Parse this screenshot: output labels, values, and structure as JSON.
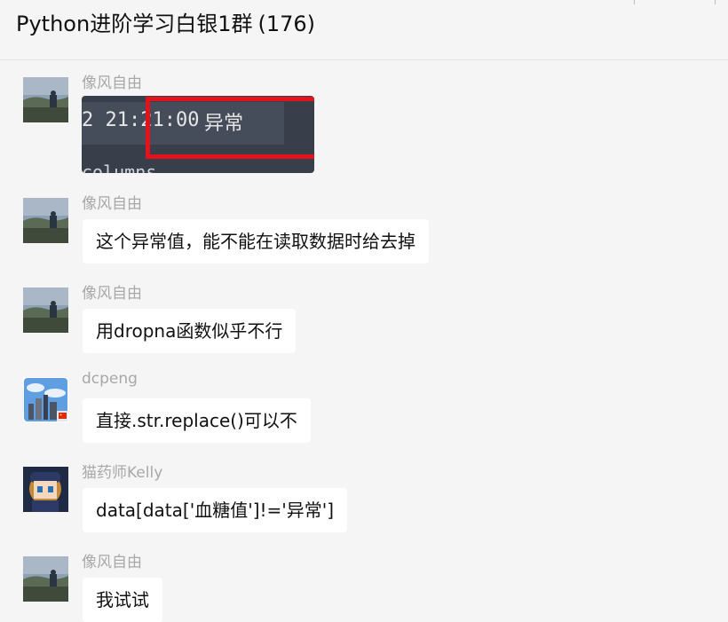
{
  "header": {
    "title": "Python进阶学习白银1群",
    "count": "(176)"
  },
  "messages": [
    {
      "sender": "像风自由",
      "type": "image",
      "avatar": "landscape-avatar",
      "image": {
        "time_text": "2 21:21:00",
        "status_text": "异常",
        "code_text": "columns",
        "highlight_color": "#e3121b"
      }
    },
    {
      "sender": "像风自由",
      "type": "text",
      "avatar": "landscape-avatar",
      "text": "这个异常值，能不能在读取数据时给去掉"
    },
    {
      "sender": "像风自由",
      "type": "text",
      "avatar": "landscape-avatar",
      "text": "用dropna函数似乎不行"
    },
    {
      "sender": "dcpeng",
      "type": "text",
      "avatar": "city-skyline-avatar",
      "text": "直接.str.replace()可以不"
    },
    {
      "sender": "猫药师Kelly",
      "type": "text",
      "avatar": "anime-character-avatar",
      "text": "data[data['血糖值']!='异常']"
    },
    {
      "sender": "像风自由",
      "type": "text",
      "avatar": "landscape-avatar",
      "text": "我试试"
    }
  ],
  "colors": {
    "background": "#f5f5f5",
    "bubble": "#ffffff",
    "sender_name": "#a8a8a8",
    "highlight": "#e3121b"
  }
}
